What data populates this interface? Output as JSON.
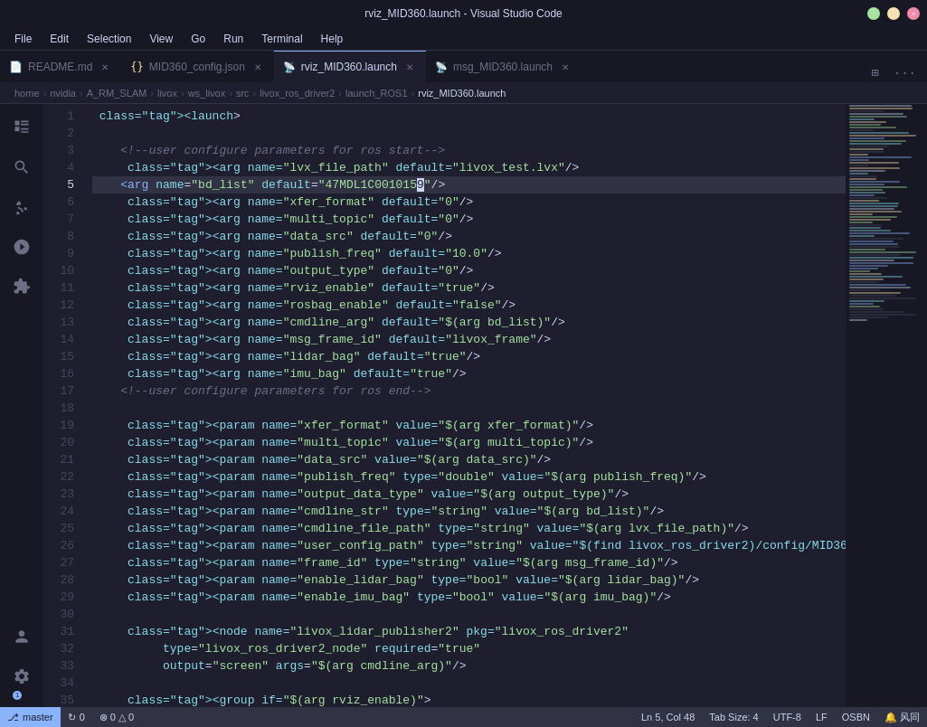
{
  "titleBar": {
    "title": "rviz_MID360.launch - Visual Studio Code"
  },
  "menuBar": {
    "items": [
      "File",
      "Edit",
      "Selection",
      "View",
      "Go",
      "Run",
      "Terminal",
      "Help"
    ]
  },
  "tabs": [
    {
      "id": "readme",
      "icon": "readme-icon",
      "iconSymbol": "📄",
      "label": "README.md",
      "active": false,
      "modified": false
    },
    {
      "id": "mid360-config",
      "icon": "json-icon",
      "iconSymbol": "{}",
      "label": "MID360_config.json",
      "active": false,
      "modified": false
    },
    {
      "id": "rviz-launch",
      "icon": "launch-icon",
      "iconSymbol": "📡",
      "label": "rviz_MID360.launch",
      "active": true,
      "modified": false
    },
    {
      "id": "msg-launch",
      "icon": "launch-icon",
      "iconSymbol": "📡",
      "label": "msg_MID360.launch",
      "active": false,
      "modified": false
    }
  ],
  "breadcrumb": {
    "items": [
      "home",
      "nvidia",
      "A_RM_SLAM",
      "livox",
      "ws_livox",
      "src",
      "livox_ros_driver2",
      "launch_ROS1",
      "rviz_MID360.launch"
    ]
  },
  "editor": {
    "activeLine": 5,
    "cursorCol": 48,
    "tabSize": 4,
    "encoding": "UTF-8",
    "lineEnding": "LF",
    "language": "OSBN",
    "lines": [
      {
        "num": 1,
        "content": "<launch>"
      },
      {
        "num": 2,
        "content": ""
      },
      {
        "num": 3,
        "content": "    <!--user configure parameters for ros start-->"
      },
      {
        "num": 4,
        "content": "    <arg name=\"lvx_file_path\" default=\"livox_test.lvx\"/>"
      },
      {
        "num": 5,
        "content": "    <arg name=\"bd_list\" default=\"47MDL1C0010159\"/>"
      },
      {
        "num": 6,
        "content": "    <arg name=\"xfer_format\" default=\"0\"/>"
      },
      {
        "num": 7,
        "content": "    <arg name=\"multi_topic\" default=\"0\"/>"
      },
      {
        "num": 8,
        "content": "    <arg name=\"data_src\" default=\"0\"/>"
      },
      {
        "num": 9,
        "content": "    <arg name=\"publish_freq\" default=\"10.0\"/>"
      },
      {
        "num": 10,
        "content": "    <arg name=\"output_type\" default=\"0\"/>"
      },
      {
        "num": 11,
        "content": "    <arg name=\"rviz_enable\" default=\"true\"/>"
      },
      {
        "num": 12,
        "content": "    <arg name=\"rosbag_enable\" default=\"false\"/>"
      },
      {
        "num": 13,
        "content": "    <arg name=\"cmdline_arg\" default=\"$(arg bd_list)\"/>"
      },
      {
        "num": 14,
        "content": "    <arg name=\"msg_frame_id\" default=\"livox_frame\"/>"
      },
      {
        "num": 15,
        "content": "    <arg name=\"lidar_bag\" default=\"true\"/>"
      },
      {
        "num": 16,
        "content": "    <arg name=\"imu_bag\" default=\"true\"/>"
      },
      {
        "num": 17,
        "content": "    <!--user configure parameters for ros end-->"
      },
      {
        "num": 18,
        "content": ""
      },
      {
        "num": 19,
        "content": "    <param name=\"xfer_format\" value=\"$(arg xfer_format)\"/>"
      },
      {
        "num": 20,
        "content": "    <param name=\"multi_topic\" value=\"$(arg multi_topic)\"/>"
      },
      {
        "num": 21,
        "content": "    <param name=\"data_src\" value=\"$(arg data_src)\"/>"
      },
      {
        "num": 22,
        "content": "    <param name=\"publish_freq\" type=\"double\" value=\"$(arg publish_freq)\"/>"
      },
      {
        "num": 23,
        "content": "    <param name=\"output_data_type\" value=\"$(arg output_type)\"/>"
      },
      {
        "num": 24,
        "content": "    <param name=\"cmdline_str\" type=\"string\" value=\"$(arg bd_list)\"/>"
      },
      {
        "num": 25,
        "content": "    <param name=\"cmdline_file_path\" type=\"string\" value=\"$(arg lvx_file_path)\"/>"
      },
      {
        "num": 26,
        "content": "    <param name=\"user_config_path\" type=\"string\" value=\"$(find livox_ros_driver2)/config/MID36"
      },
      {
        "num": 27,
        "content": "    <param name=\"frame_id\" type=\"string\" value=\"$(arg msg_frame_id)\"/>"
      },
      {
        "num": 28,
        "content": "    <param name=\"enable_lidar_bag\" type=\"bool\" value=\"$(arg lidar_bag)\"/>"
      },
      {
        "num": 29,
        "content": "    <param name=\"enable_imu_bag\" type=\"bool\" value=\"$(arg imu_bag)\"/>"
      },
      {
        "num": 30,
        "content": ""
      },
      {
        "num": 31,
        "content": "    <node name=\"livox_lidar_publisher2\" pkg=\"livox_ros_driver2\""
      },
      {
        "num": 32,
        "content": "          type=\"livox_ros_driver2_node\" required=\"true\""
      },
      {
        "num": 33,
        "content": "          output=\"screen\" args=\"$(arg cmdline_arg)\"/>"
      },
      {
        "num": 34,
        "content": ""
      },
      {
        "num": 35,
        "content": "    <group if=\"$(arg rviz_enable)\">"
      }
    ]
  },
  "statusBar": {
    "branch": "master",
    "sync": "↻ 0",
    "errors": "⊗ 0 △ 0",
    "position": "Ln 5, Col 48",
    "tabSize": "Tab Size: 4",
    "encoding": "UTF-8",
    "lineEnding": "LF",
    "language": "OSBN",
    "notifications": "🔔 风同 "
  },
  "minimap": {
    "visible": true
  },
  "colors": {
    "background": "#1e1e2e",
    "activeLine": "#313244",
    "tabActive": "#1e1e2e",
    "tabInactive": "#181825",
    "accent": "#89b4fa",
    "statusBranch": "#89b4fa"
  }
}
